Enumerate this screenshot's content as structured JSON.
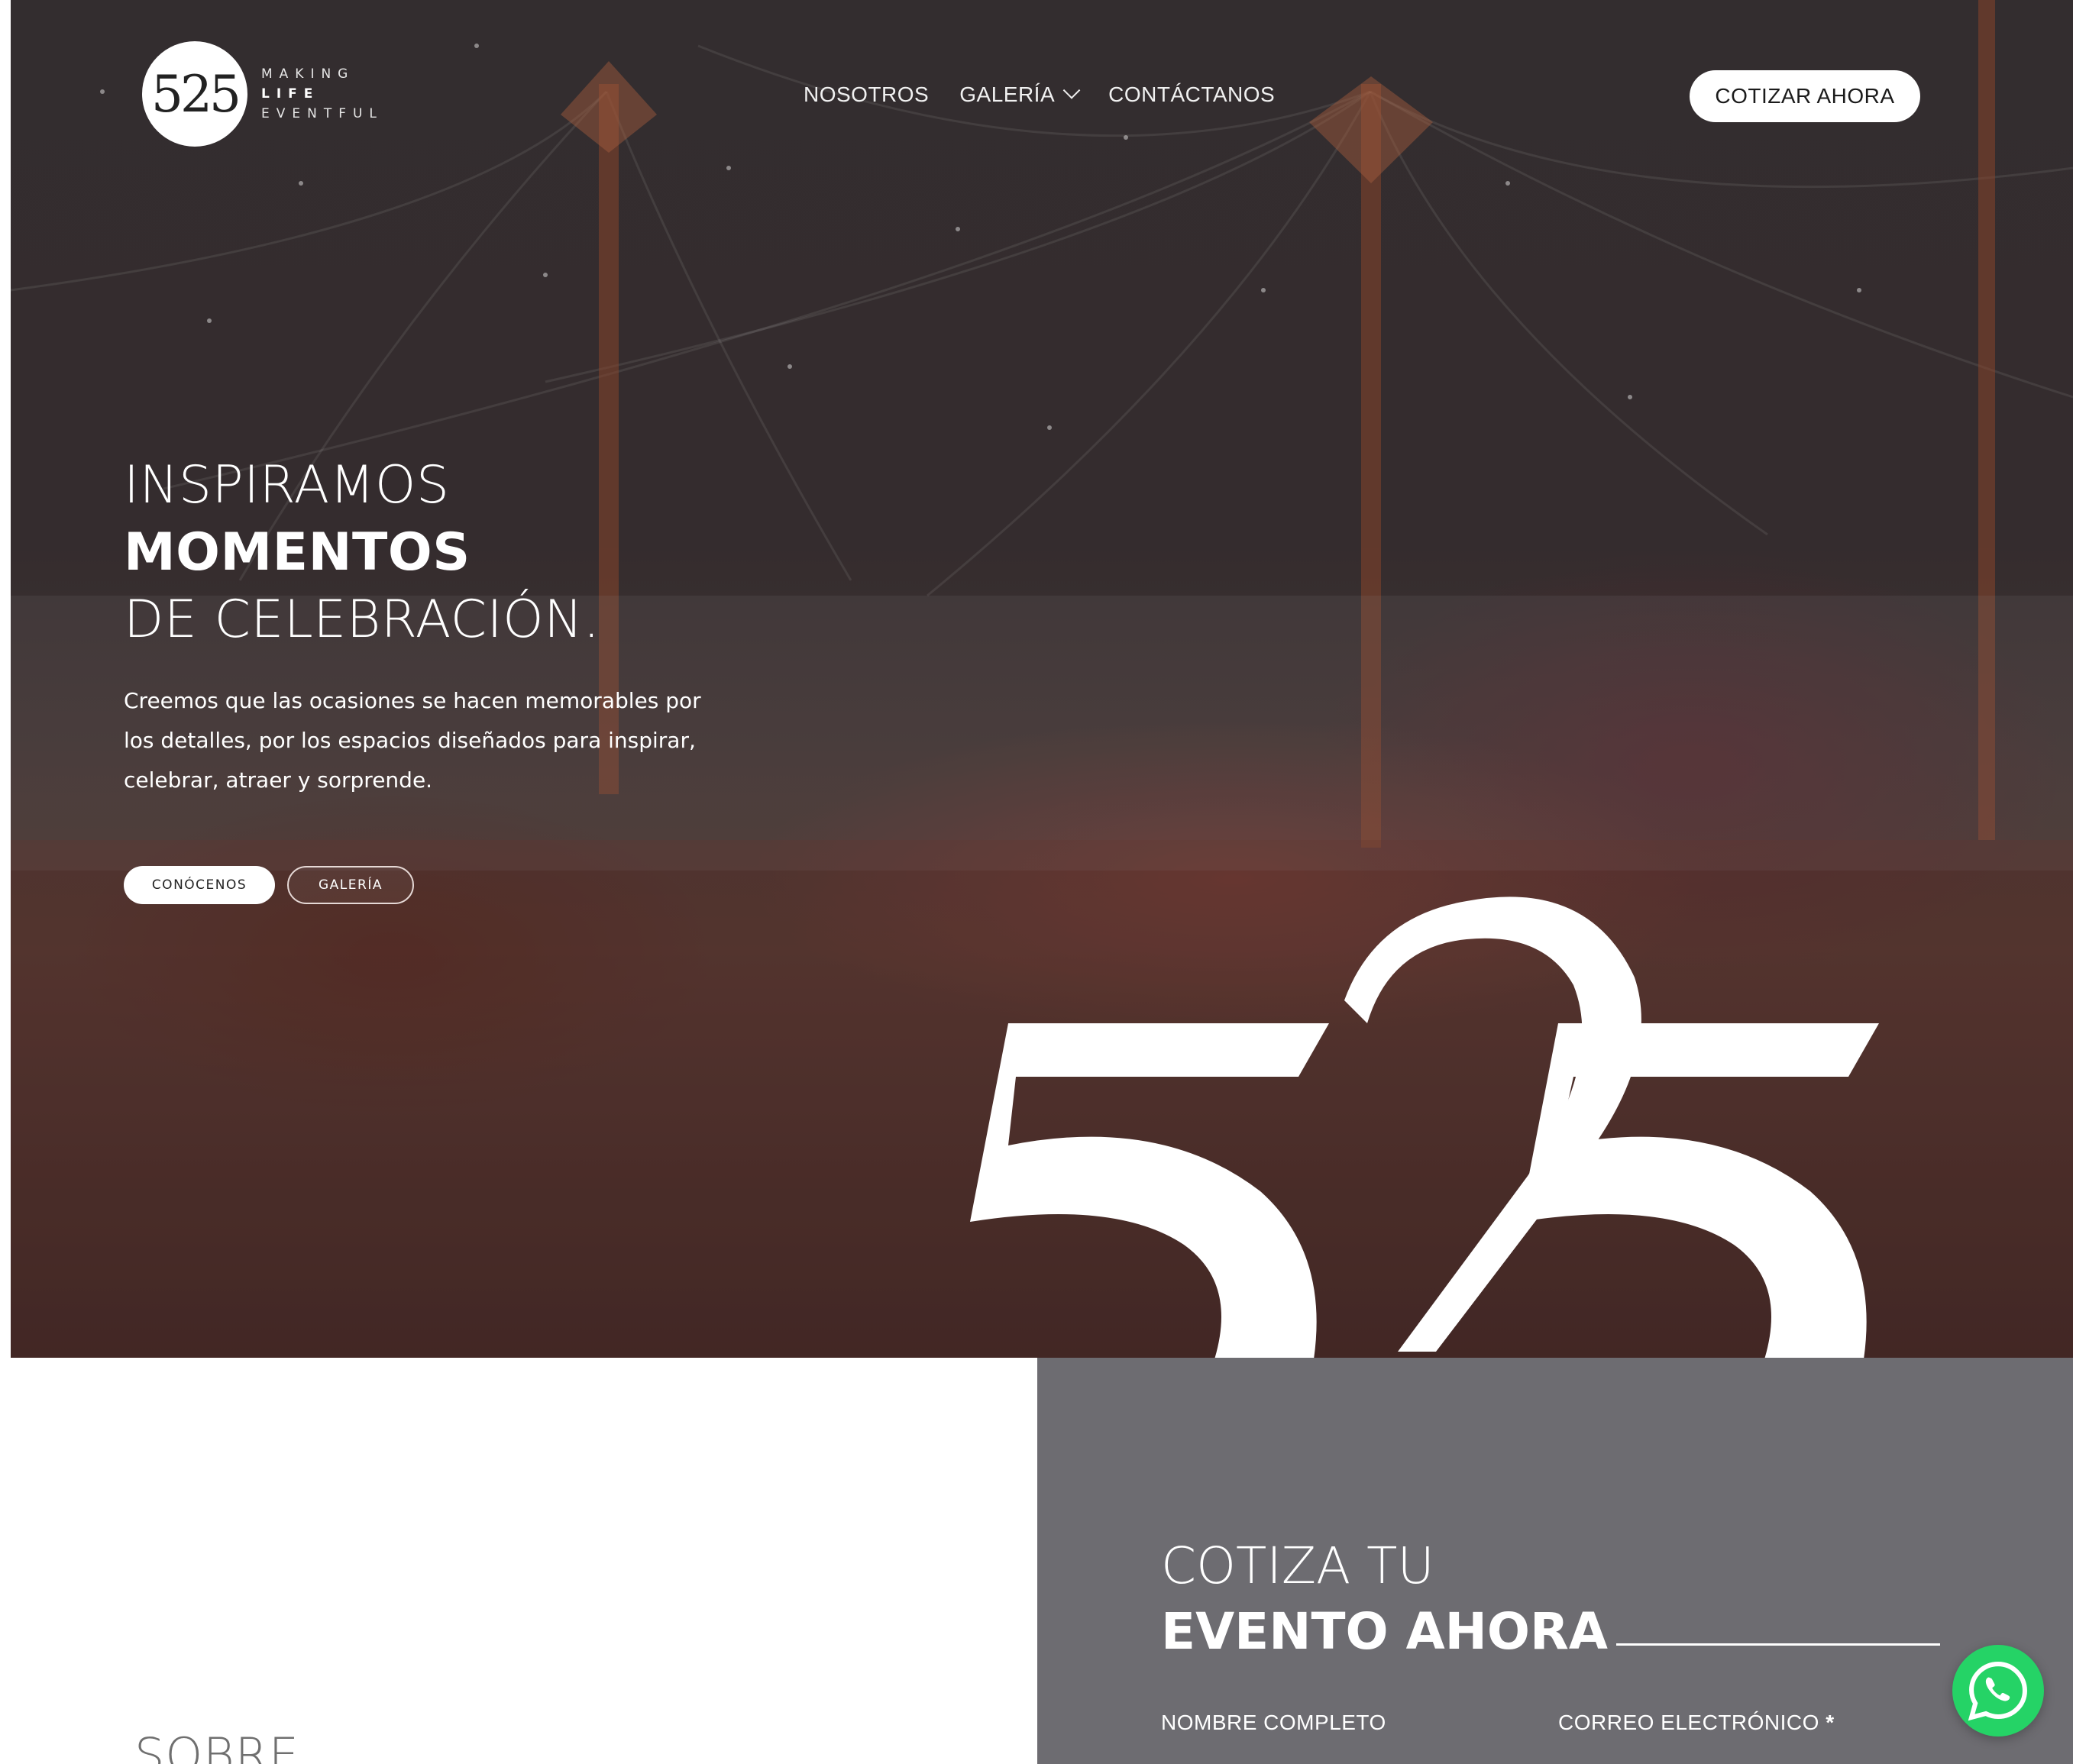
{
  "header": {
    "logo": {
      "mark": "525",
      "tagline": [
        "MAKING",
        "LIFE",
        "EVENTFUL"
      ]
    },
    "nav": [
      {
        "label": "NOSOTROS"
      },
      {
        "label": "GALERÍA",
        "has_dropdown": true
      },
      {
        "label": "CONTÁCTANOS"
      }
    ],
    "cta_label": "COTIZAR AHORA"
  },
  "hero": {
    "headline_line1": "INSPIRAMOS",
    "headline_line2": "MOMENTOS",
    "headline_line3": "DE CELEBRACIÓN.",
    "lede": "Creemos que las ocasiones se hacen memorables por los detalles, por los espacios diseñados para inspirar, celebrar, atraer y sorprende.",
    "button_primary": "CONÓCENOS",
    "button_secondary": "GALERÍA",
    "big_mark": "525"
  },
  "about": {
    "title_partial": "SOBRE"
  },
  "quote_form": {
    "title_line1": "COTIZA TU",
    "title_line2": "EVENTO AHORA",
    "field_name_label": "NOMBRE COMPLETO",
    "field_email_label": "CORREO ELECTRÓNICO",
    "required_marker": "*"
  },
  "colors": {
    "panel": "#6d6c71",
    "whatsapp": "#25d366"
  },
  "icons": {
    "whatsapp": "whatsapp-icon",
    "dropdown": "chevron-down-icon"
  }
}
